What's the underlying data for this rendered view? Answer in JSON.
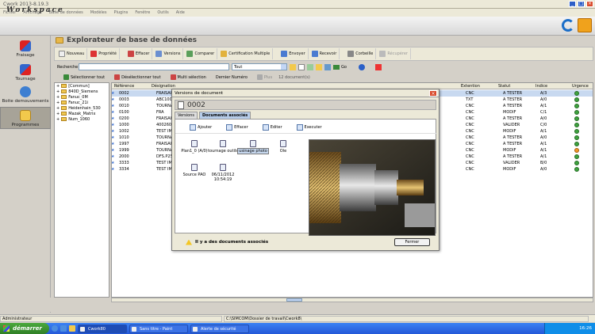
{
  "window": {
    "title": "Cwork 2013-8.19.3"
  },
  "menu": [
    "Fichier",
    "Affichage",
    "Base de données",
    "Modèles",
    "Plugins",
    "Fenêtre",
    "Outils",
    "Aide"
  ],
  "workspace": {
    "title": "Workspace"
  },
  "sidebar": {
    "items": [
      {
        "label": "Fraisage",
        "icon": "milling-icon"
      },
      {
        "label": "Tournage",
        "icon": "turning-icon"
      },
      {
        "label": "Boite demouvements",
        "icon": "movements-box-icon"
      },
      {
        "label": "Programmes",
        "icon": "programs-folder-icon",
        "active": true
      }
    ]
  },
  "explorer": {
    "title": "Explorateur de base de données"
  },
  "toolbar": [
    {
      "label": "Nouveau",
      "icon": "new-icon"
    },
    {
      "label": "Propriété",
      "icon": "properties-icon"
    },
    {
      "label": "Effacer",
      "icon": "delete-icon"
    },
    {
      "label": "Versions",
      "icon": "versions-icon"
    },
    {
      "label": "Comparer",
      "icon": "compare-icon"
    },
    {
      "label": "Certification Multiple",
      "icon": "certification-icon"
    },
    {
      "label": "Envoyer",
      "icon": "send-icon"
    },
    {
      "label": "Recevoir",
      "icon": "receive-icon"
    },
    {
      "label": "Corbeille",
      "icon": "trash-icon"
    },
    {
      "label": "Récupérer",
      "icon": "recover-icon",
      "disabled": true
    }
  ],
  "search": {
    "label": "Recherche",
    "value": "",
    "filter": "Tout",
    "go": "Go"
  },
  "selection": {
    "select_all": "Sélectionner tout",
    "deselect_all": "Désélectionner tout",
    "multi": "Multi sélection",
    "last_number": "Dernier Numéro",
    "plus": "Plus",
    "count": "12 document(s)"
  },
  "tree": [
    {
      "label": "[Commun]"
    },
    {
      "label": "840D_Siemens"
    },
    {
      "label": "Fanuc_0M"
    },
    {
      "label": "Fanuc_21i"
    },
    {
      "label": "Heidenhain_530"
    },
    {
      "label": "Mazak_Matrix"
    },
    {
      "label": "Num_1060"
    }
  ],
  "grid": {
    "columns": {
      "ref": "Référence",
      "des": "Désignation",
      "ext": "Extention",
      "status": "Statut",
      "index": "Indice",
      "urg": "Urgence"
    },
    "rows": [
      {
        "ref": "0002",
        "des": "FRAISAGE",
        "ext": "CNC",
        "status": "A TESTER",
        "index": "A/3",
        "urg": "green",
        "sel": true
      },
      {
        "ref": "0003",
        "des": "ABC100",
        "ext": "TXT",
        "status": "A TESTER",
        "index": "A/0",
        "urg": "green"
      },
      {
        "ref": "0010",
        "des": "TOURNA",
        "ext": "CNC",
        "status": "A TESTER",
        "index": "A/1",
        "urg": "green"
      },
      {
        "ref": "0100",
        "des": "FRA",
        "ext": "CNC",
        "status": "MODIF",
        "index": "C/1",
        "urg": "green"
      },
      {
        "ref": "0200",
        "des": "FRAISAGE",
        "ext": "CNC",
        "status": "A TESTER",
        "index": "A/0",
        "urg": "green"
      },
      {
        "ref": "1000",
        "des": "4002600",
        "ext": "CNC",
        "status": "VALIDER",
        "index": "C/0",
        "urg": "green"
      },
      {
        "ref": "1002",
        "des": "TEST IMF",
        "ext": "CNC",
        "status": "MODIF",
        "index": "A/1",
        "urg": "green"
      },
      {
        "ref": "1010",
        "des": "TOURNA",
        "ext": "CNC",
        "status": "A TESTER",
        "index": "A/0",
        "urg": "green"
      },
      {
        "ref": "1997",
        "des": "FRAISAGE",
        "ext": "CNC",
        "status": "A TESTER",
        "index": "A/1",
        "urg": "green"
      },
      {
        "ref": "1999",
        "des": "TOURNA",
        "ext": "CNC",
        "status": "MODIF",
        "index": "A/1",
        "urg": "orange"
      },
      {
        "ref": "2000",
        "des": "DFS.P254",
        "ext": "CNC",
        "status": "A TESTER",
        "index": "A/1",
        "urg": "green"
      },
      {
        "ref": "3333",
        "des": "TEST IMF",
        "ext": "CNC",
        "status": "VALIDER",
        "index": "B/0",
        "urg": "green"
      },
      {
        "ref": "3334",
        "des": "TEST IMF",
        "ext": "CNC",
        "status": "MODIF",
        "index": "A/0",
        "urg": "green"
      }
    ]
  },
  "dialog": {
    "title": "Versions de document",
    "doc_number": "0002",
    "tabs": [
      "Versions",
      "Documents associés"
    ],
    "tools": [
      "Ajouter",
      "Effacer",
      "Editer",
      "Executer"
    ],
    "files": [
      {
        "label": "Plan1_0 (A/0)"
      },
      {
        "label": "tournage outils"
      },
      {
        "label": "usinage photo",
        "selected": true
      },
      {
        "label": "Ole"
      },
      {
        "label": "Source PAO"
      },
      {
        "label": "06/11/2012 10:54:19"
      }
    ],
    "footer": "Il y a des documents associés",
    "close": "Fermer"
  },
  "status": {
    "user": "Administrateur",
    "path": "C:\\SIMCOM\\Dossier de travail\\Cwork8\\"
  },
  "taskbar": {
    "start": "démarrer",
    "tasks": [
      "Cwork80",
      "Sans titre - Paint",
      "Alerte de sécurité"
    ],
    "clock": "16:26"
  }
}
